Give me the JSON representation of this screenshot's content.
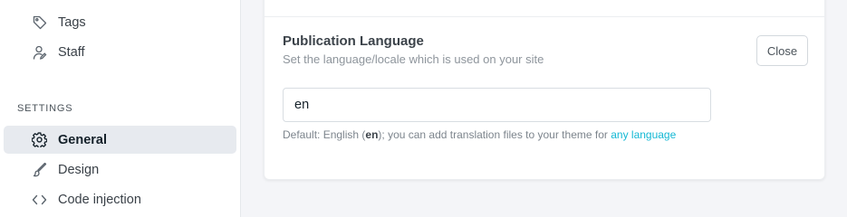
{
  "sidebar": {
    "items_top": [
      {
        "label": "Tags",
        "icon": "tag-icon"
      },
      {
        "label": "Staff",
        "icon": "staff-icon"
      }
    ],
    "settings_title": "SETTINGS",
    "items_settings": [
      {
        "label": "General",
        "icon": "gear-icon",
        "active": true
      },
      {
        "label": "Design",
        "icon": "brush-icon"
      },
      {
        "label": "Code injection",
        "icon": "code-icon"
      }
    ]
  },
  "setting": {
    "title": "Publication Language",
    "description": "Set the language/locale which is used on your site",
    "close_label": "Close",
    "input_value": "en",
    "hint_prefix": "Default: English (",
    "hint_code": "en",
    "hint_middle": "); you can add translation files to your theme for ",
    "hint_link": "any language"
  },
  "colors": {
    "accent_link": "#14b8d4",
    "active_bg": "#e7eaef",
    "page_bg": "#f4f5f8"
  }
}
